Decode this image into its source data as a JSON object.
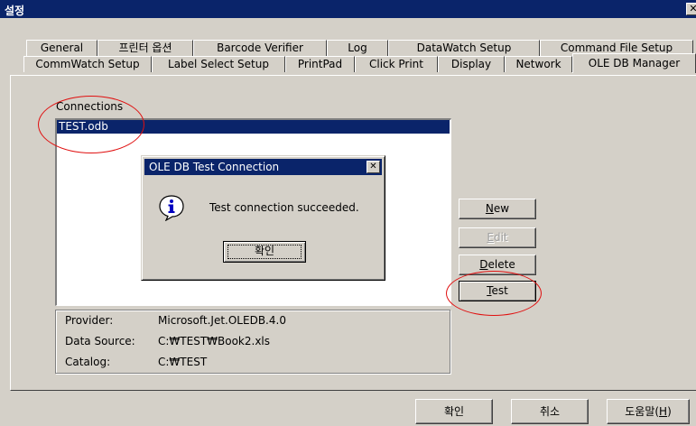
{
  "window": {
    "title": "설정",
    "close_glyph": "✕"
  },
  "tabs_row1": [
    {
      "label": "General"
    },
    {
      "label": "프린터 옵션"
    },
    {
      "label": "Barcode Verifier"
    },
    {
      "label": "Log"
    },
    {
      "label": "DataWatch Setup"
    },
    {
      "label": "Command File Setup"
    }
  ],
  "tabs_row2": [
    {
      "label": "CommWatch Setup"
    },
    {
      "label": "Label Select Setup"
    },
    {
      "label": "PrintPad"
    },
    {
      "label": "Click Print"
    },
    {
      "label": "Display"
    },
    {
      "label": "Network"
    },
    {
      "label": "OLE DB Manager",
      "active": true
    }
  ],
  "connections": {
    "label": "Connections",
    "items": [
      "TEST.odb"
    ],
    "selected_index": 0
  },
  "info": {
    "provider_label": "Provider:",
    "provider_value": "Microsoft.Jet.OLEDB.4.0",
    "data_source_label": "Data Source:",
    "data_source_value": "C:₩TEST₩Book2.xls",
    "catalog_label": "Catalog:",
    "catalog_value": "C:₩TEST"
  },
  "side_buttons": {
    "new": {
      "pre": "",
      "mnemonic": "N",
      "post": "ew"
    },
    "edit": {
      "pre": "",
      "mnemonic": "E",
      "post": "dit",
      "disabled": true
    },
    "delete": {
      "pre": "",
      "mnemonic": "D",
      "post": "elete"
    },
    "test": {
      "pre": "",
      "mnemonic": "T",
      "post": "est"
    }
  },
  "bottom_buttons": {
    "ok": "확인",
    "cancel": "취소",
    "help_pre": "도움말(",
    "help_mnemonic": "H",
    "help_post": ")"
  },
  "dialog": {
    "title": "OLE DB Test Connection",
    "close_glyph": "✕",
    "icon": "info-icon",
    "message": "Test connection succeeded.",
    "ok_label": "확인"
  },
  "annotations": {
    "color": "#e01010"
  },
  "colors": {
    "titlebar": "#0a246a",
    "face": "#d4d0c8",
    "selection": "#0a246a"
  }
}
